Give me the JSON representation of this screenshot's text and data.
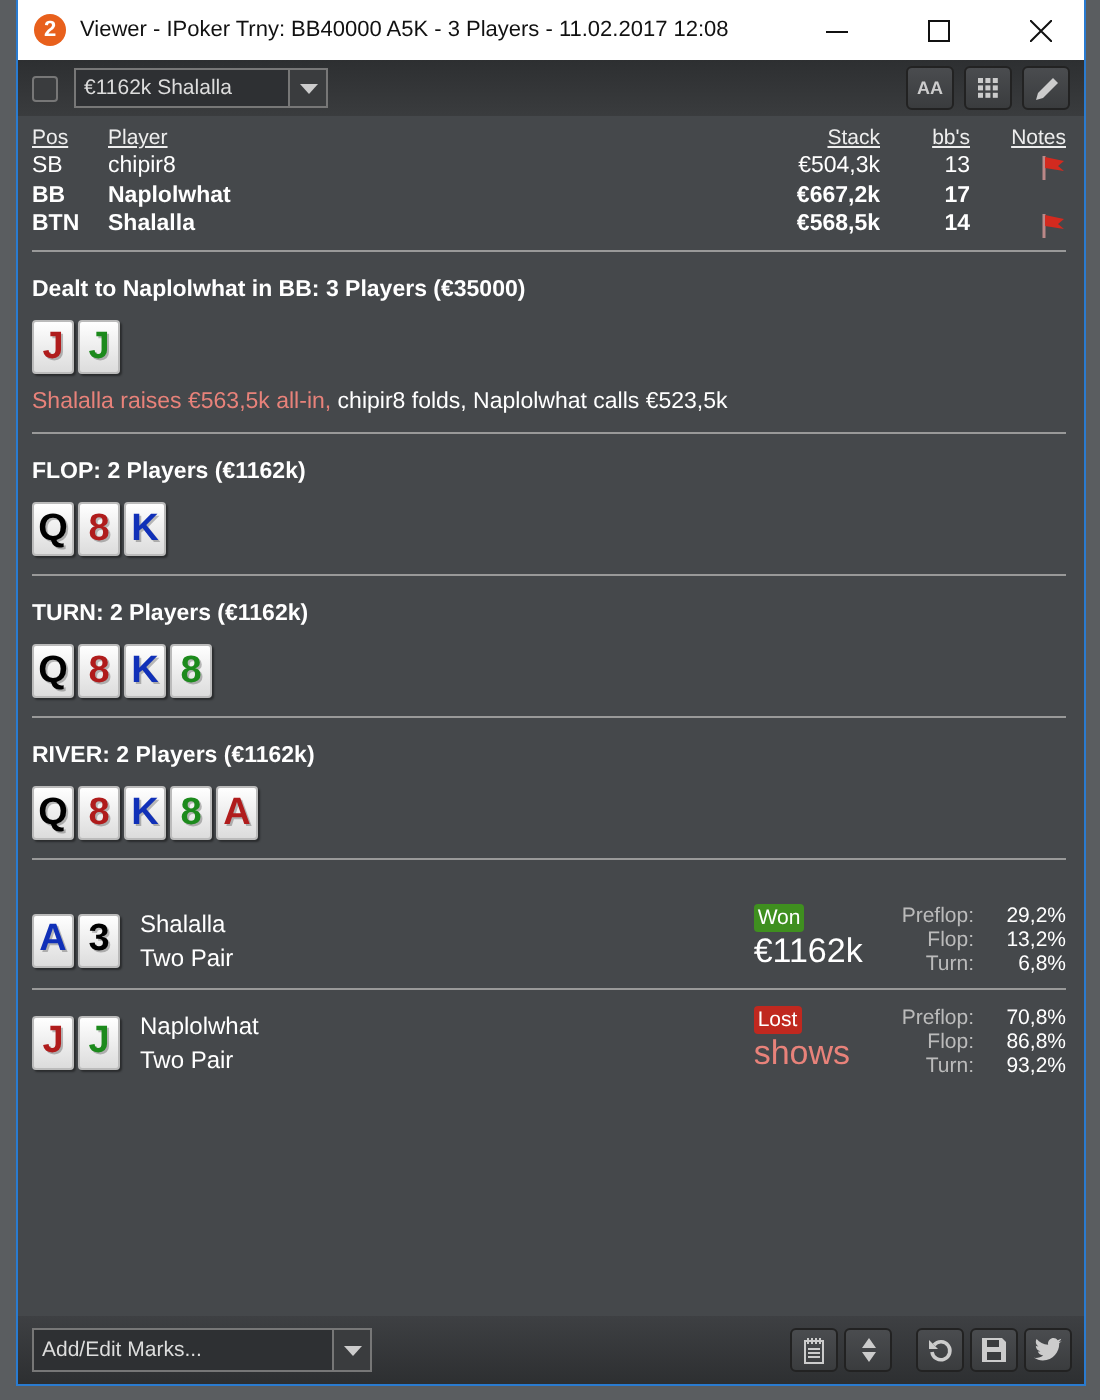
{
  "window": {
    "app_icon_text": "2",
    "title": "Viewer - IPoker Trny: BB40000 A5K - 3 Players - 11.02.2017 12:08"
  },
  "toolbar": {
    "checkbox": {
      "checked": false
    },
    "hand_select": {
      "value": "€1162k Shalalla"
    },
    "font_button": {
      "label": "AA"
    }
  },
  "players_table": {
    "columns": [
      "Pos",
      "Player",
      "Stack",
      "bb's",
      "Notes"
    ],
    "rows": [
      {
        "pos": "SB",
        "player": "chipir8",
        "stack": "€504,3k",
        "bbs": "13",
        "bold": false,
        "flag": true
      },
      {
        "pos": "BB",
        "player": "Naplolwhat",
        "stack": "€667,2k",
        "bbs": "17",
        "bold": true,
        "flag": false
      },
      {
        "pos": "BTN",
        "player": "Shalalla",
        "stack": "€568,5k",
        "bbs": "14",
        "bold": true,
        "flag": true
      }
    ]
  },
  "streets": [
    {
      "title": "Dealt to Naplolwhat in BB: 3 Players (€35000)",
      "cards": [
        {
          "rank": "J",
          "color": "#b01c1c"
        },
        {
          "rank": "J",
          "color": "#1c8a1c"
        }
      ],
      "actions": [
        {
          "text": "Shalalla raises €563,5k all-in,",
          "aggressive": true
        },
        {
          "text": "chipir8 folds, Naplolwhat calls €523,5k",
          "aggressive": false
        }
      ]
    },
    {
      "title": "FLOP: 2 Players (€1162k)",
      "cards": [
        {
          "rank": "Q",
          "color": "#000000"
        },
        {
          "rank": "8",
          "color": "#b01c1c"
        },
        {
          "rank": "K",
          "color": "#1030b8"
        }
      ]
    },
    {
      "title": "TURN: 2 Players (€1162k)",
      "cards": [
        {
          "rank": "Q",
          "color": "#000000"
        },
        {
          "rank": "8",
          "color": "#b01c1c"
        },
        {
          "rank": "K",
          "color": "#1030b8"
        },
        {
          "rank": "8",
          "color": "#1c8a1c"
        }
      ]
    },
    {
      "title": "RIVER: 2 Players (€1162k)",
      "cards": [
        {
          "rank": "Q",
          "color": "#000000"
        },
        {
          "rank": "8",
          "color": "#b01c1c"
        },
        {
          "rank": "K",
          "color": "#1030b8"
        },
        {
          "rank": "8",
          "color": "#1c8a1c"
        },
        {
          "rank": "A",
          "color": "#b01c1c"
        }
      ]
    }
  ],
  "showdown": [
    {
      "cards": [
        {
          "rank": "A",
          "color": "#1030b8"
        },
        {
          "rank": "3",
          "color": "#000000"
        }
      ],
      "player": "Shalalla",
      "hand": "Two Pair",
      "result": {
        "kind": "won",
        "label": "Won",
        "amount": "€1162k"
      },
      "equity": [
        {
          "label": "Preflop:",
          "value": "29,2%"
        },
        {
          "label": "Flop:",
          "value": "13,2%"
        },
        {
          "label": "Turn:",
          "value": "6,8%"
        }
      ]
    },
    {
      "cards": [
        {
          "rank": "J",
          "color": "#b01c1c"
        },
        {
          "rank": "J",
          "color": "#1c8a1c"
        }
      ],
      "player": "Naplolwhat",
      "hand": "Two Pair",
      "result": {
        "kind": "lost",
        "label": "Lost",
        "amount": "shows"
      },
      "equity": [
        {
          "label": "Preflop:",
          "value": "70,8%"
        },
        {
          "label": "Flop:",
          "value": "86,8%"
        },
        {
          "label": "Turn:",
          "value": "93,2%"
        }
      ]
    }
  ],
  "bottom_bar": {
    "marks_select": {
      "value": "Add/Edit Marks..."
    }
  }
}
